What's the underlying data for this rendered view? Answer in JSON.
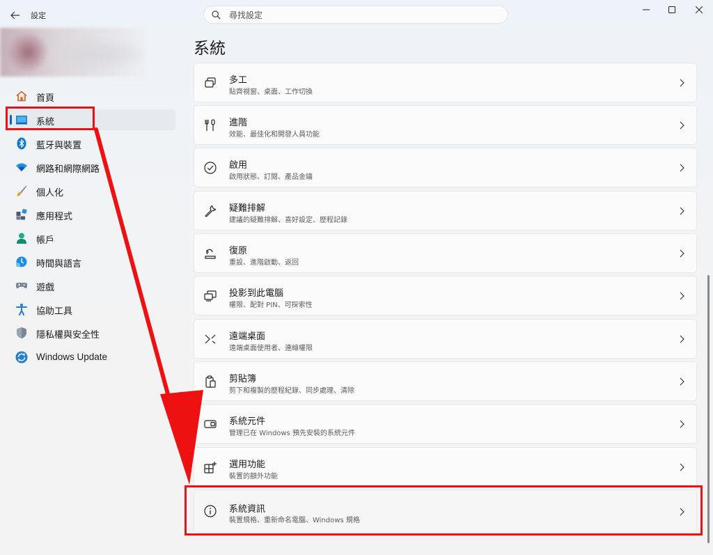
{
  "window": {
    "app_title": "設定",
    "controls": [
      "minimize",
      "maximize",
      "close"
    ]
  },
  "search": {
    "placeholder": "尋找設定"
  },
  "sidebar": {
    "items": [
      {
        "label": "首頁",
        "icon": "home-icon"
      },
      {
        "label": "系統",
        "icon": "system-display-icon",
        "selected": true
      },
      {
        "label": "藍牙與裝置",
        "icon": "bluetooth-icon"
      },
      {
        "label": "網路和網際網路",
        "icon": "wifi-icon"
      },
      {
        "label": "個人化",
        "icon": "brush-icon"
      },
      {
        "label": "應用程式",
        "icon": "apps-icon"
      },
      {
        "label": "帳戶",
        "icon": "account-icon"
      },
      {
        "label": "時間與語言",
        "icon": "time-language-icon"
      },
      {
        "label": "遊戲",
        "icon": "gamepad-icon"
      },
      {
        "label": "協助工具",
        "icon": "accessibility-icon"
      },
      {
        "label": "隱私權與安全性",
        "icon": "shield-icon"
      },
      {
        "label": "Windows Update",
        "icon": "windows-update-icon"
      }
    ]
  },
  "main": {
    "title": "系統",
    "cards": [
      {
        "title": "多工",
        "subtitle": "貼齊視窗、桌面、工作切換",
        "icon": "multitasking-icon"
      },
      {
        "title": "進階",
        "subtitle": "效能、最佳化和開發人員功能",
        "icon": "advanced-icon"
      },
      {
        "title": "啟用",
        "subtitle": "啟用狀態、訂閱、產品金鑰",
        "icon": "activation-icon"
      },
      {
        "title": "疑難排解",
        "subtitle": "建議的疑難排解、喜好設定、歷程記錄",
        "icon": "wrench-icon"
      },
      {
        "title": "復原",
        "subtitle": "重設、進階啟動、返回",
        "icon": "recovery-icon"
      },
      {
        "title": "投影到此電腦",
        "subtitle": "權限、配對 PIN、可探索性",
        "icon": "projection-icon"
      },
      {
        "title": "遠端桌面",
        "subtitle": "遠端桌面使用者、連線權限",
        "icon": "remote-desktop-icon"
      },
      {
        "title": "剪貼簿",
        "subtitle": "剪下和複製的歷程紀錄、同步處理、清除",
        "icon": "clipboard-icon"
      },
      {
        "title": "系統元件",
        "subtitle": "管理已在 Windows 預先安裝的系統元件",
        "icon": "system-components-icon"
      },
      {
        "title": "選用功能",
        "subtitle": "裝置的額外功能",
        "icon": "optional-features-icon"
      },
      {
        "title": "系統資訊",
        "subtitle": "裝置規格、重新命名電腦、Windows 規格",
        "icon": "info-icon"
      }
    ]
  },
  "colors": {
    "accent": "#0067c0",
    "annotation_red": "#ee1111"
  }
}
